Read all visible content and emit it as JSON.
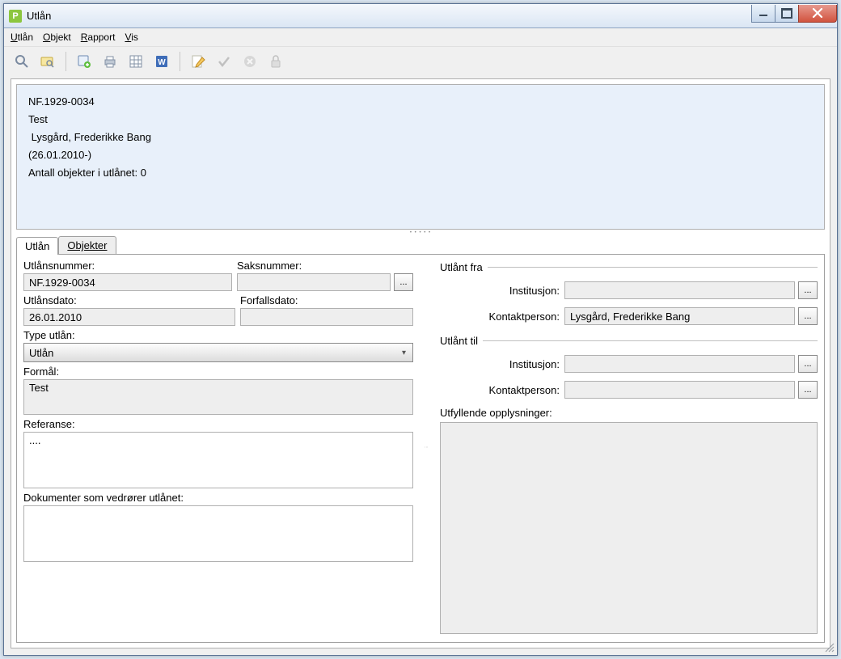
{
  "window": {
    "title": "Utlån"
  },
  "menu": {
    "utlan": "Utlån",
    "objekt": "Objekt",
    "rapport": "Rapport",
    "vis": "Vis"
  },
  "summary": {
    "line1": "NF.1929-0034",
    "line2": "Test",
    "line3": " Lysgård, Frederikke Bang",
    "line4": "(26.01.2010-)",
    "line5": "Antall objekter i utlånet: 0"
  },
  "tabs": {
    "utlan": "Utlån",
    "objekter": "Objekter"
  },
  "labels": {
    "utlansnummer": "Utlånsnummer:",
    "saksnummer": "Saksnummer:",
    "utlansdato": "Utlånsdato:",
    "forfallsdato": "Forfallsdato:",
    "type_utlan": "Type utlån:",
    "formal": "Formål:",
    "referanse": "Referanse:",
    "dokumenter": "Dokumenter som vedrører utlånet:",
    "utlant_fra": "Utlånt fra",
    "utlant_til": "Utlånt til",
    "institusjon": "Institusjon:",
    "kontaktperson": "Kontaktperson:",
    "utfyllende": "Utfyllende opplysninger:"
  },
  "values": {
    "utlansnummer": "NF.1929-0034",
    "saksnummer": "",
    "utlansdato": "26.01.2010",
    "forfallsdato": "",
    "type_utlan": "Utlån",
    "formal": "Test",
    "referanse": "....",
    "dokumenter": "",
    "fra_institusjon": "",
    "fra_kontaktperson": "Lysgård, Frederikke Bang",
    "til_institusjon": "",
    "til_kontaktperson": "",
    "utfyllende": ""
  },
  "buttons": {
    "ellipsis": "..."
  },
  "toolbar_icons": [
    "search-icon",
    "search-folder-icon",
    "new-icon",
    "print-icon",
    "table-icon",
    "word-icon",
    "edit-icon",
    "check-icon",
    "cancel-icon",
    "lock-icon"
  ]
}
